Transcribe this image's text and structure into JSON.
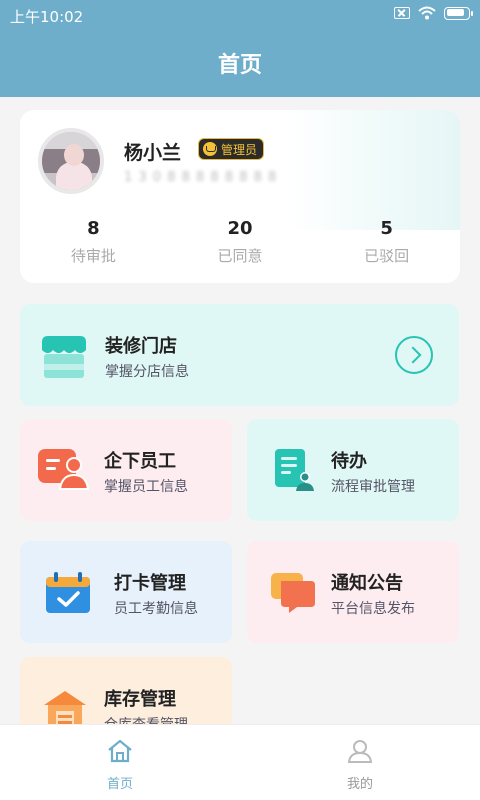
{
  "status": {
    "time": "上午10:02"
  },
  "header": {
    "title": "首页"
  },
  "profile": {
    "name": "杨小兰",
    "role_badge": "管理员",
    "phone": "1 3 0 8 8 8 8 8 8 8 8"
  },
  "stats": [
    {
      "value": "8",
      "label": "待审批"
    },
    {
      "value": "20",
      "label": "已同意"
    },
    {
      "value": "5",
      "label": "已驳回"
    }
  ],
  "menu": {
    "shop": {
      "title": "装修门店",
      "subtitle": "掌握分店信息"
    },
    "staff": {
      "title": "企下员工",
      "subtitle": "掌握员工信息"
    },
    "todo": {
      "title": "待办",
      "subtitle": "流程审批管理"
    },
    "clock": {
      "title": "打卡管理",
      "subtitle": "员工考勤信息"
    },
    "notice": {
      "title": "通知公告",
      "subtitle": "平台信息发布"
    },
    "stock": {
      "title": "库存管理",
      "subtitle": "仓库查看管理"
    }
  },
  "nav": {
    "items": [
      {
        "label": "首页",
        "icon": "home-icon",
        "active": true
      },
      {
        "label": "我的",
        "icon": "user-icon",
        "active": false
      }
    ]
  },
  "colors": {
    "header": "#6faecb",
    "teal": "#27c3b3",
    "nav_active": "#6faecb",
    "nav_inactive": "#999999"
  }
}
